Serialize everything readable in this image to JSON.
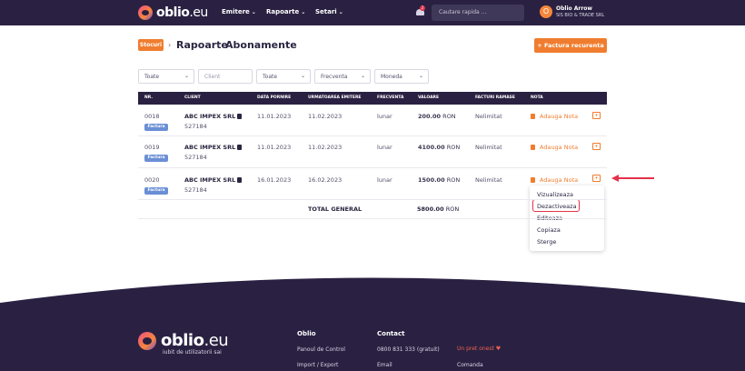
{
  "nav": {
    "brand": "oblio",
    "brand_suffix": ".eu",
    "links": [
      "Emitere",
      "Rapoarte",
      "Setari"
    ],
    "notif_count": "2",
    "search_placeholder": "Cautare rapida ...",
    "user_initial": "O",
    "user_name": "Oblio Arrow",
    "user_company": "SIS BIO & TRADE SRL"
  },
  "breadcrumb": {
    "badge": "Stocuri",
    "items": [
      "Rapoarte",
      "Abonamente"
    ]
  },
  "add_button": "+ Factura recurenta",
  "filters": {
    "f1": "Toate",
    "client_placeholder": "Client",
    "f3": "Toate",
    "freq": "Frecventa",
    "currency": "Moneda"
  },
  "table": {
    "headers": [
      "NR.",
      "CLIENT",
      "DATA PORNIRE",
      "URMATOAREA EMITERE",
      "FRECVENTA",
      "VALOARE",
      "FACTURI RAMASE",
      "NOTA"
    ],
    "rows": [
      {
        "nr": "0018",
        "tag": "Factura",
        "client": "ABC IMPEX SRL",
        "client_id": "527184",
        "start": "11.01.2023",
        "next": "11.02.2023",
        "freq": "lunar",
        "value": "200.00",
        "currency": "RON",
        "left": "Nelimitat",
        "note": "Adauga Nota"
      },
      {
        "nr": "0019",
        "tag": "Factura",
        "client": "ABC IMPEX SRL",
        "client_id": "527184",
        "start": "11.01.2023",
        "next": "11.02.2023",
        "freq": "lunar",
        "value": "4100.00",
        "currency": "RON",
        "left": "Nelimitat",
        "note": "Adauga Nota"
      },
      {
        "nr": "0020",
        "tag": "Factura",
        "client": "ABC IMPEX SRL",
        "client_id": "527184",
        "start": "16.01.2023",
        "next": "16.02.2023",
        "freq": "lunar",
        "value": "1500.00",
        "currency": "RON",
        "left": "Nelimitat",
        "note": "Adauga Nota"
      }
    ],
    "total_label": "TOTAL GENERAL",
    "total_value": "5800.00",
    "total_currency": "RON"
  },
  "menu": {
    "items": [
      "Vizualizeaza",
      "Dezactiveaza",
      "Editeaza",
      "Copiaza",
      "Sterge"
    ]
  },
  "footer": {
    "brand": "oblio",
    "brand_suffix": ".eu",
    "tagline": "iubit de utilizatorii sai",
    "col1": {
      "title": "Oblio",
      "links": [
        "Panoul de Control",
        "Import / Export"
      ]
    },
    "col2": {
      "title": "Contact",
      "links": [
        "0800 831 333 (gratuit)",
        "Email"
      ]
    },
    "col3": {
      "links": [
        "Un pret onest",
        "Comanda"
      ]
    }
  },
  "colors": {
    "nav_bg": "#2a2142",
    "accent": "#f07d2f",
    "highlight": "#e5334a"
  }
}
